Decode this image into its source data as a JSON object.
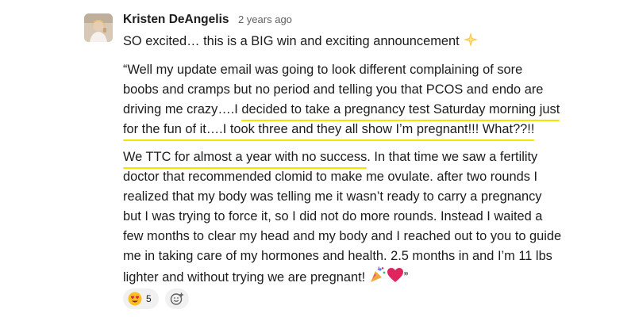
{
  "message": {
    "author": "Kristen DeAngelis",
    "timestamp": "2 years ago",
    "lines": {
      "l1": "SO excited… this is a BIG win and exciting announcement",
      "l2": "“Well my update email was going to look different complaining of sore",
      "l3": "boobs and cramps but no period and telling you that PCOS and endo are",
      "l4_pre": "driving me crazy….I ",
      "l4_hl": "decided to take a pregnancy test Saturday morning just",
      "l5_hl": "for the fun of it….I took three and they all show I’m pregnant!!! What??!!",
      "l6_hl": "We TTC for almost a year with no success",
      "l6_post": ". In that time we saw a fertility",
      "l7": "doctor that recommended clomid to make me ovulate. after two rounds I",
      "l8": "realized that my body was telling me it wasn’t ready to carry a pregnancy",
      "l9": "but I was trying to force it, so I did not do more rounds. Instead I waited a",
      "l10": "few months to clear my head and my body and I reached out to you to guide",
      "l11": "me in taking care of my hormones and health. 2.5 months in and I’m 11 lbs",
      "l12_pre": "lighter and without trying we are pregnant! ",
      "l12_post": "”"
    },
    "icons": {
      "sparkle": "sparkle-icon",
      "party": "party-popper-icon",
      "heart": "red-heart-icon"
    }
  },
  "reactions": [
    {
      "emoji": "heart-eyes-emoji",
      "count": "5"
    }
  ],
  "add_reaction": {
    "icon": "add-reaction-icon"
  },
  "colors": {
    "highlight": "#f2e600",
    "text": "#1d1c1d",
    "timestamp": "#616061",
    "reaction_bg": "#f1f1f1"
  }
}
